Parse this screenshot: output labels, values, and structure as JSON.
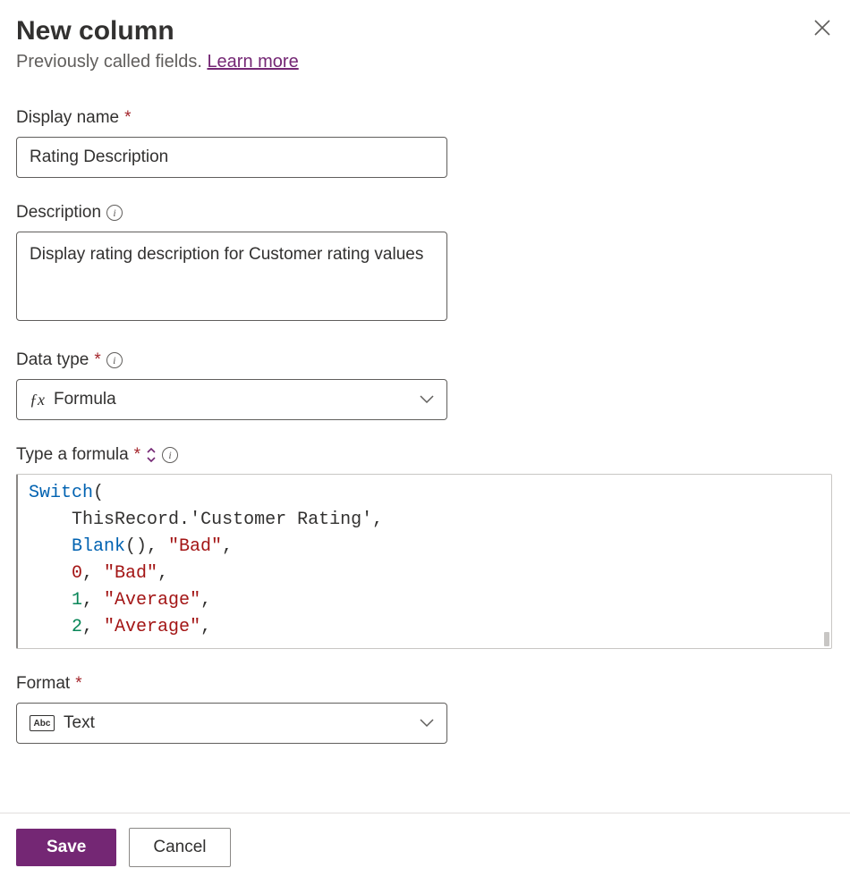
{
  "header": {
    "title": "New column",
    "subtitle_prefix": "Previously called fields. ",
    "learn_more": "Learn more"
  },
  "fields": {
    "display_name": {
      "label": "Display name",
      "value": "Rating Description"
    },
    "description": {
      "label": "Description",
      "value": "Display rating description for Customer rating values"
    },
    "data_type": {
      "label": "Data type",
      "value": "Formula"
    },
    "formula": {
      "label": "Type a formula",
      "tokens": {
        "switch": "Switch",
        "thisrec": "ThisRecord",
        "field": "'Customer Rating'",
        "blank": "Blank",
        "bad": "\"Bad\"",
        "avg": "\"Average\"",
        "n0": "0",
        "n1": "1",
        "n2": "2"
      }
    },
    "format": {
      "label": "Format",
      "value": "Text"
    }
  },
  "footer": {
    "save": "Save",
    "cancel": "Cancel"
  }
}
